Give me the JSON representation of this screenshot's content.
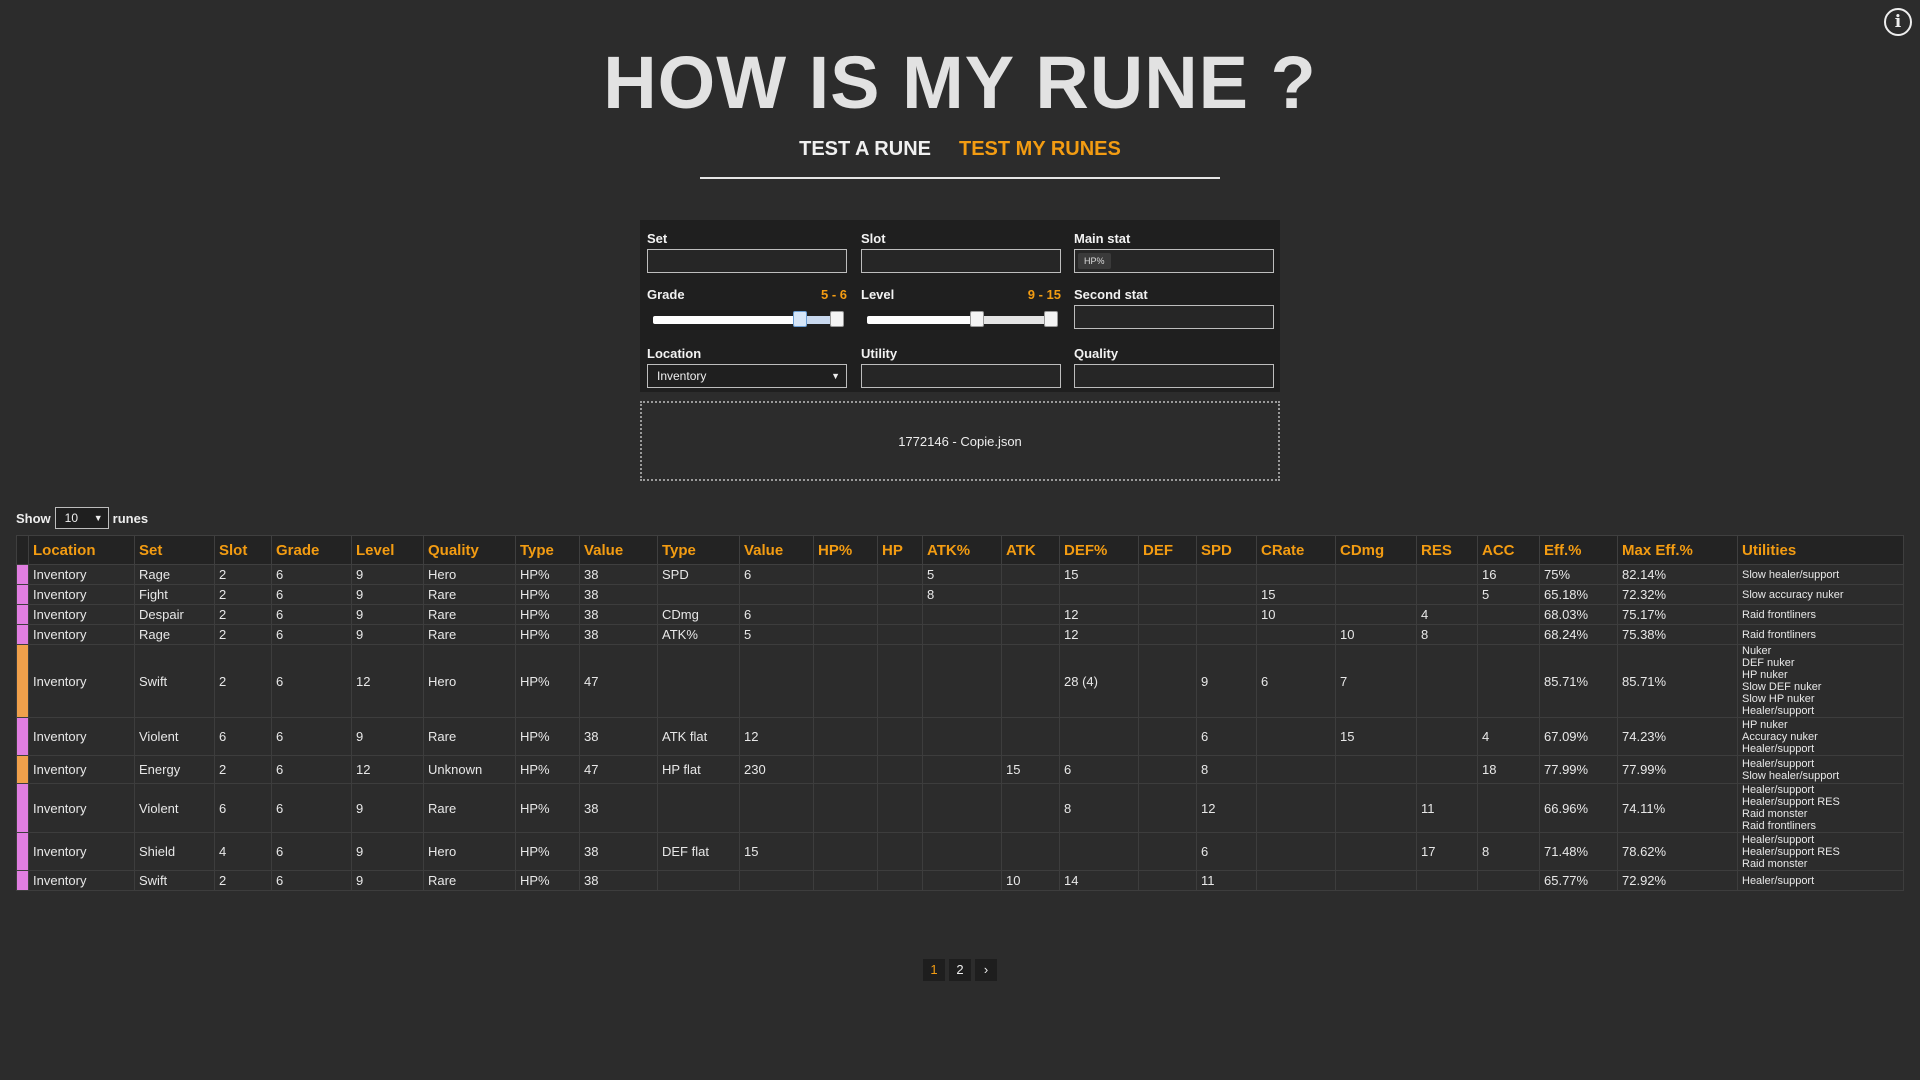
{
  "header": {
    "title": "HOW IS MY RUNE ?"
  },
  "tabs": [
    {
      "label": "TEST A RUNE",
      "active": false
    },
    {
      "label": "TEST MY RUNES",
      "active": true
    }
  ],
  "filters": {
    "set": {
      "label": "Set",
      "value": ""
    },
    "slot": {
      "label": "Slot",
      "value": ""
    },
    "main_stat": {
      "label": "Main stat",
      "chip": "HP%"
    },
    "grade": {
      "label": "Grade",
      "range_text": "5 - 6",
      "min": 5,
      "max": 6
    },
    "level": {
      "label": "Level",
      "range_text": "9 - 15",
      "min": 9,
      "max": 15
    },
    "second_stat": {
      "label": "Second stat",
      "value": ""
    },
    "location": {
      "label": "Location",
      "value": "Inventory"
    },
    "utility": {
      "label": "Utility",
      "value": ""
    },
    "quality": {
      "label": "Quality",
      "value": ""
    }
  },
  "dropzone": {
    "file": "1772146 - Copie.json"
  },
  "show": {
    "prefix": "Show",
    "value": "10",
    "suffix": "runes"
  },
  "table": {
    "columns": [
      "Location",
      "Set",
      "Slot",
      "Grade",
      "Level",
      "Quality",
      "Type",
      "Value",
      "Type",
      "Value",
      "HP%",
      "HP",
      "ATK%",
      "ATK",
      "DEF%",
      "DEF",
      "SPD",
      "CRate",
      "CDmg",
      "RES",
      "ACC",
      "Eff.%",
      "Max Eff.%",
      "Utilities"
    ],
    "rows": [
      {
        "marker": "#e07ee0",
        "cells": [
          "Inventory",
          "Rage",
          "2",
          "6",
          "9",
          "Hero",
          "HP%",
          "38",
          "SPD",
          "6",
          "",
          "",
          "5",
          "",
          "15",
          "",
          "",
          "",
          "",
          "",
          "16",
          "75%",
          "82.14%"
        ],
        "utilities": [
          "Slow healer/support"
        ]
      },
      {
        "marker": "#e07ee0",
        "cells": [
          "Inventory",
          "Fight",
          "2",
          "6",
          "9",
          "Rare",
          "HP%",
          "38",
          "",
          "",
          "",
          "",
          "8",
          "",
          "",
          "",
          "",
          "15",
          "",
          "",
          "5",
          "65.18%",
          "72.32%"
        ],
        "utilities": [
          "Slow accuracy nuker"
        ]
      },
      {
        "marker": "#e07ee0",
        "cells": [
          "Inventory",
          "Despair",
          "2",
          "6",
          "9",
          "Rare",
          "HP%",
          "38",
          "CDmg",
          "6",
          "",
          "",
          "",
          "",
          "12",
          "",
          "",
          "10",
          "",
          "4",
          "",
          "68.03%",
          "75.17%"
        ],
        "utilities": [
          "Raid frontliners"
        ]
      },
      {
        "marker": "#e07ee0",
        "cells": [
          "Inventory",
          "Rage",
          "2",
          "6",
          "9",
          "Rare",
          "HP%",
          "38",
          "ATK%",
          "5",
          "",
          "",
          "",
          "",
          "12",
          "",
          "",
          "",
          "10",
          "8",
          "",
          "68.24%",
          "75.38%"
        ],
        "utilities": [
          "Raid frontliners"
        ]
      },
      {
        "marker": "#f0a04b",
        "cells": [
          "Inventory",
          "Swift",
          "2",
          "6",
          "12",
          "Hero",
          "HP%",
          "47",
          "",
          "",
          "",
          "",
          "",
          "",
          "28 (4)",
          "",
          "9",
          "6",
          "7",
          "",
          "",
          "85.71%",
          "85.71%"
        ],
        "highlight_col": 14,
        "utilities": [
          "Nuker",
          "DEF nuker",
          "HP nuker",
          "Slow DEF nuker",
          "Slow HP nuker",
          "Healer/support"
        ]
      },
      {
        "marker": "#e07ee0",
        "cells": [
          "Inventory",
          "Violent",
          "6",
          "6",
          "9",
          "Rare",
          "HP%",
          "38",
          "ATK flat",
          "12",
          "",
          "",
          "",
          "",
          "",
          "",
          "6",
          "",
          "15",
          "",
          "4",
          "67.09%",
          "74.23%"
        ],
        "utilities": [
          "HP nuker",
          "Accuracy nuker",
          "Healer/support"
        ]
      },
      {
        "marker": "#f0a04b",
        "cells": [
          "Inventory",
          "Energy",
          "2",
          "6",
          "12",
          "Unknown",
          "HP%",
          "47",
          "HP flat",
          "230",
          "",
          "",
          "",
          "15",
          "6",
          "",
          "8",
          "",
          "",
          "",
          "18",
          "77.99%",
          "77.99%"
        ],
        "utilities": [
          "Healer/support",
          "Slow healer/support"
        ]
      },
      {
        "marker": "#e07ee0",
        "cells": [
          "Inventory",
          "Violent",
          "6",
          "6",
          "9",
          "Rare",
          "HP%",
          "38",
          "",
          "",
          "",
          "",
          "",
          "",
          "8",
          "",
          "12",
          "",
          "",
          "11",
          "",
          "66.96%",
          "74.11%"
        ],
        "utilities": [
          "Healer/support",
          "Healer/support RES",
          "Raid monster",
          "Raid frontliners"
        ]
      },
      {
        "marker": "#e07ee0",
        "cells": [
          "Inventory",
          "Shield",
          "4",
          "6",
          "9",
          "Hero",
          "HP%",
          "38",
          "DEF flat",
          "15",
          "",
          "",
          "",
          "",
          "",
          "",
          "6",
          "",
          "",
          "17",
          "8",
          "71.48%",
          "78.62%"
        ],
        "utilities": [
          "Healer/support",
          "Healer/support RES",
          "Raid monster"
        ]
      },
      {
        "marker": "#e07ee0",
        "cells": [
          "Inventory",
          "Swift",
          "2",
          "6",
          "9",
          "Rare",
          "HP%",
          "38",
          "",
          "",
          "",
          "",
          "",
          "10",
          "14",
          "",
          "11",
          "",
          "",
          "",
          "",
          "65.77%",
          "72.92%"
        ],
        "utilities": [
          "Healer/support"
        ]
      }
    ]
  },
  "pagination": {
    "pages": [
      "1",
      "2"
    ],
    "active": "1",
    "next": "›"
  },
  "colors": {
    "accent": "#f39c12",
    "background": "#2c2c2c"
  }
}
